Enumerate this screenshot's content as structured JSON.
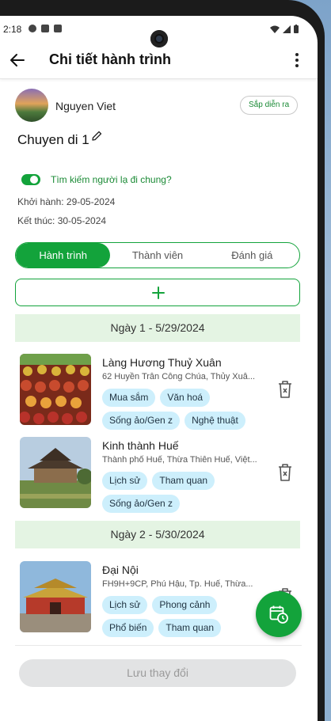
{
  "status_bar": {
    "time": "2:18"
  },
  "header": {
    "title": "Chi tiết hành trình"
  },
  "owner": {
    "name": "Nguyen Viet",
    "status": "Sắp diễn ra"
  },
  "trip": {
    "name": "Chuyen di 1",
    "toggle_label": "Tìm kiếm người lạ đi chung?",
    "toggle_on": true,
    "start": "Khởi hành: 29-05-2024",
    "end": "Kết thúc: 30-05-2024"
  },
  "tabs": [
    {
      "label": "Hành trình",
      "active": true
    },
    {
      "label": "Thành viên",
      "active": false
    },
    {
      "label": "Đánh giá",
      "active": false
    }
  ],
  "days": [
    {
      "label": "Ngày 1 - 5/29/2024",
      "places": [
        {
          "name": "Làng Hương Thuỷ Xuân",
          "address": "62 Huyền Trân Công Chúa, Thủy Xuâ...",
          "tags": [
            "Mua sắm",
            "Văn hoá",
            "Sống ảo/Gen z",
            "Nghệ thuật"
          ]
        },
        {
          "name": "Kinh thành Huế",
          "address": "Thành phố Huế, Thừa Thiên Huế, Việt...",
          "tags": [
            "Lịch sử",
            "Tham quan",
            "Sống ảo/Gen z"
          ]
        }
      ]
    },
    {
      "label": "Ngày 2 - 5/30/2024",
      "places": [
        {
          "name": "Đại Nội",
          "address": "FH9H+9CP, Phú Hậu, Tp. Huế, Thừa...",
          "tags": [
            "Lịch sử",
            "Phong cảnh",
            "Phổ biến",
            "Tham quan"
          ]
        }
      ]
    }
  ],
  "footer": {
    "save_label": "Lưu thay đổi"
  },
  "colors": {
    "accent": "#13a33b",
    "tag_bg": "#cdeffc",
    "day_header_bg": "#e4f4e3"
  },
  "icons": [
    "back-arrow-icon",
    "more-vertical-icon",
    "edit-pencil-icon",
    "plus-icon",
    "trash-icon",
    "calendar-clock-icon"
  ]
}
